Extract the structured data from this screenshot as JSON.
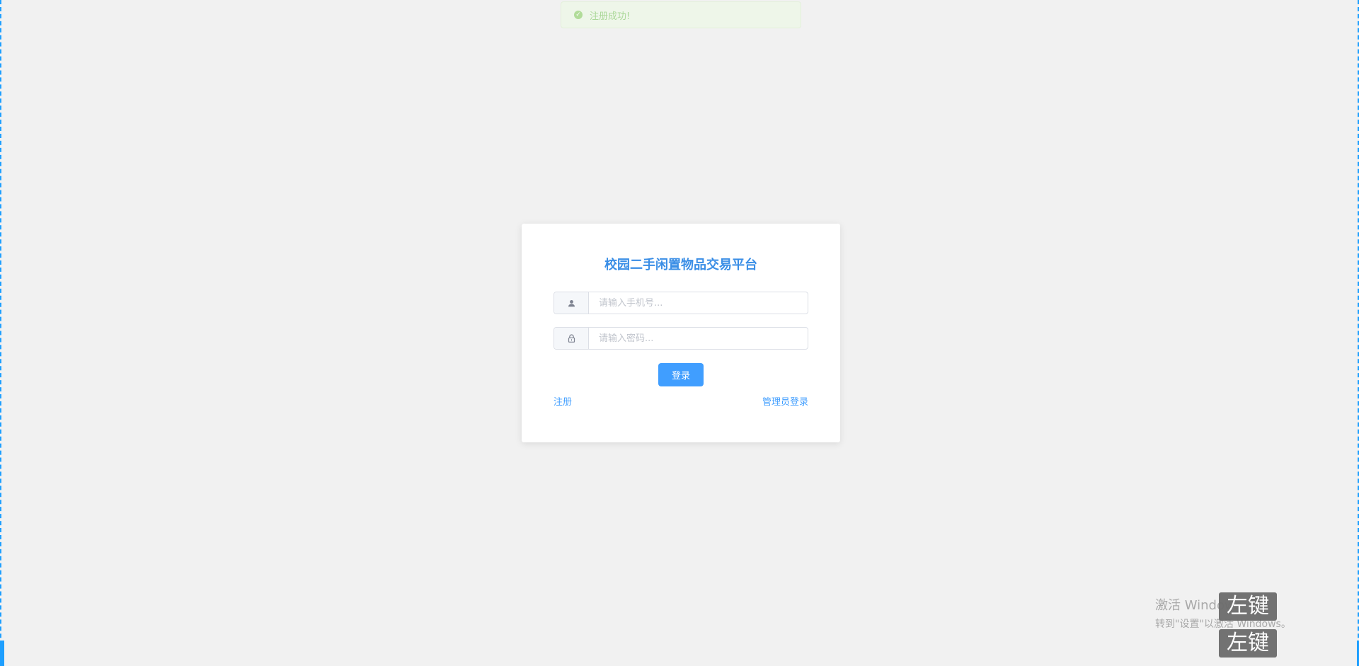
{
  "toast": {
    "message": "注册成功!",
    "icon": "check-circle-icon",
    "color": "#9fd48a"
  },
  "login": {
    "title": "校园二手闲置物品交易平台",
    "phone": {
      "icon": "user-icon",
      "placeholder": "请输入手机号...",
      "value": ""
    },
    "password": {
      "icon": "lock-icon",
      "placeholder": "请输入密码...",
      "value": ""
    },
    "submit_label": "登录",
    "register_label": "注册",
    "admin_login_label": "管理员登录",
    "accent_color": "#409eff"
  },
  "watermark": {
    "line1": "激活 Windows",
    "line2": "转到\"设置\"以激活 Windows。"
  },
  "overlay_badges": [
    "左键",
    "左键"
  ]
}
